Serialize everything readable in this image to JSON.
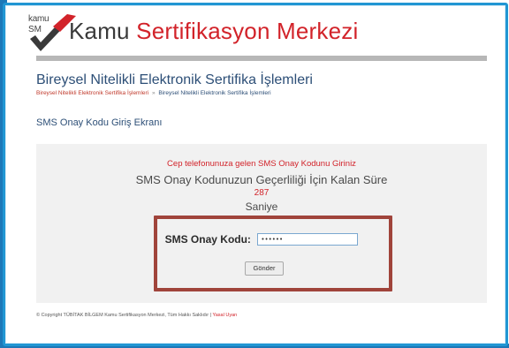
{
  "header": {
    "logo_top": "kamu",
    "logo_bottom": "SM",
    "brand_part1": "Kamu",
    "brand_part2": "Sertifikasyon Merkezi"
  },
  "page": {
    "title": "Bireysel Nitelikli Elektronik Sertifika İşlemleri",
    "breadcrumb": [
      "Bireysel Nitelikli Elektronik Sertifika İşlemleri",
      "Bireysel Nitelikli Elektronik Sertifika İşlemleri"
    ],
    "breadcrumb_separator": "»",
    "section_title": "SMS Onay Kodu Giriş Ekranı"
  },
  "panel": {
    "instruction": "Cep telefonunuza gelen SMS Onay Kodunu Giriniz",
    "remaining_label": "SMS Onay Kodunuzun Geçerliliği İçin Kalan Süre",
    "seconds_value": "287",
    "seconds_unit": "Saniye",
    "code_label": "SMS Onay Kodu:",
    "code_value": "••••••",
    "send_label": "Gönder"
  },
  "footer": {
    "copyright": "© Copyright TÜBİTAK BİLGEM Kamu Sertifikasyon Merkezi, Tüm Hakkı Saklıdır | ",
    "link": "Yasal Uyarı"
  },
  "colors": {
    "brand_red": "#d2232a",
    "title_blue": "#2d4f77",
    "frame_blue": "#2196d3",
    "highlight": "#a0443b"
  }
}
